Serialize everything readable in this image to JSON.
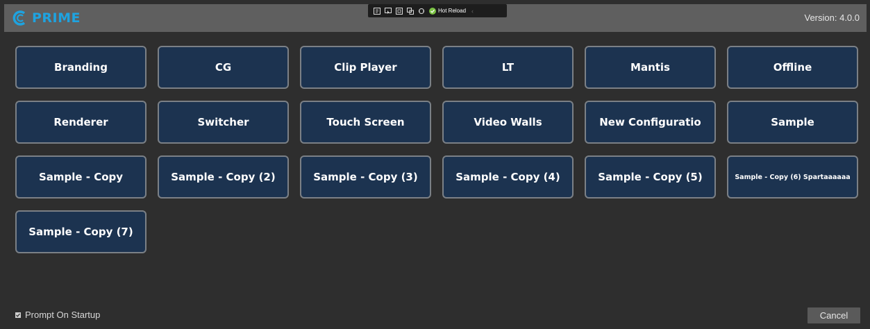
{
  "header": {
    "logo_text": "PRIME",
    "version": "Version: 4.0.0",
    "brand_color": "#1ea3e0"
  },
  "devtools": {
    "icons": [
      "live-visual-tree-icon",
      "select-element-icon",
      "display-layout-adorners-icon",
      "track-focused-element-icon",
      "binding-failures-icon"
    ],
    "hot_reload_label": "Hot Reload"
  },
  "configurations": [
    {
      "label": "Branding"
    },
    {
      "label": "CG"
    },
    {
      "label": "Clip Player"
    },
    {
      "label": "LT"
    },
    {
      "label": "Mantis"
    },
    {
      "label": "Offline"
    },
    {
      "label": "Renderer"
    },
    {
      "label": "Switcher"
    },
    {
      "label": "Touch Screen"
    },
    {
      "label": "Video Walls"
    },
    {
      "label": "New Configuratio"
    },
    {
      "label": "Sample"
    },
    {
      "label": "Sample - Copy"
    },
    {
      "label": "Sample - Copy (2)"
    },
    {
      "label": "Sample - Copy (3)"
    },
    {
      "label": "Sample - Copy (4)"
    },
    {
      "label": "Sample - Copy (5)"
    },
    {
      "label": "Sample - Copy (6) Spartaaaaaa",
      "small": true
    },
    {
      "label": "Sample - Copy (7)"
    }
  ],
  "footer": {
    "prompt_on_startup_label": "Prompt On Startup",
    "prompt_on_startup_checked": true,
    "cancel_label": "Cancel"
  }
}
